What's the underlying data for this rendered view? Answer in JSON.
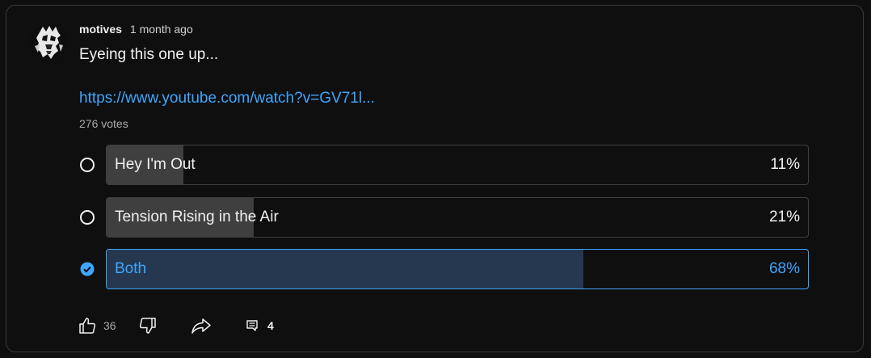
{
  "post": {
    "author": "motives",
    "time": "1 month ago",
    "text": "Eyeing this one up...",
    "link": "https://www.youtube.com/watch?v=GV71l..."
  },
  "poll": {
    "votes": "276 votes",
    "options": [
      {
        "label": "Hey I'm Out",
        "percent_text": "11%",
        "percent": 11,
        "selected": false
      },
      {
        "label": "Tension Rising in the Air",
        "percent_text": "21%",
        "percent": 21,
        "selected": false
      },
      {
        "label": "Both",
        "percent_text": "68%",
        "percent": 68,
        "selected": true
      }
    ]
  },
  "actions": {
    "like_count": "36",
    "comment_count": "4",
    "icons": [
      "thumbs-up-icon",
      "thumbs-down-icon",
      "share-icon",
      "comment-icon"
    ]
  },
  "colors": {
    "background": "#0f0f0f",
    "accent": "#3ea6ff",
    "bar_fill": "#3f3f3f",
    "selected_fill": "#263850"
  }
}
